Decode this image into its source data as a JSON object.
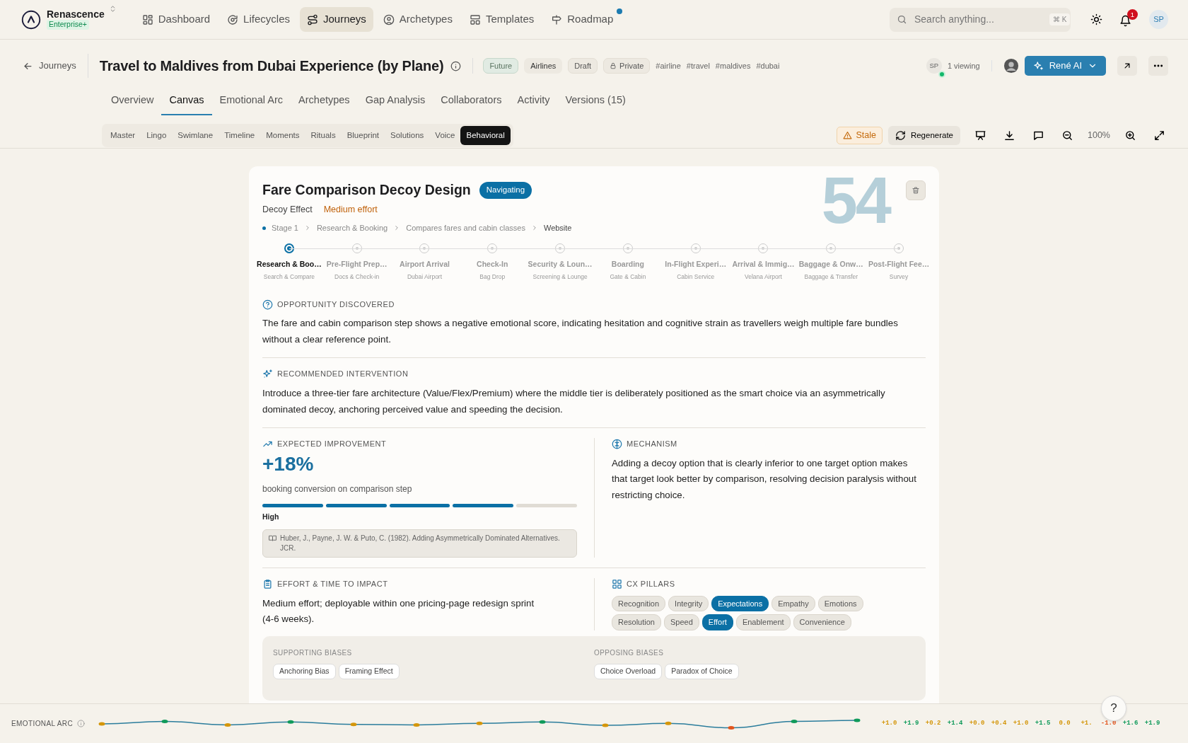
{
  "brand": {
    "name": "Renascence",
    "plan": "Enterprise+"
  },
  "nav": [
    {
      "label": "Dashboard",
      "selected": false,
      "has_update": false
    },
    {
      "label": "Lifecycles",
      "selected": false,
      "has_update": false
    },
    {
      "label": "Journeys",
      "selected": true,
      "has_update": false
    },
    {
      "label": "Archetypes",
      "selected": false,
      "has_update": false
    },
    {
      "label": "Templates",
      "selected": false,
      "has_update": false
    },
    {
      "label": "Roadmap",
      "selected": false,
      "has_update": true
    }
  ],
  "search": {
    "placeholder": "Search anything...",
    "shortcut": "⌘ K"
  },
  "notifications": "1",
  "user_initials": "SP",
  "header": {
    "back": "Journeys",
    "title": "Travel to Maldives from Dubai Experience (by Plane)",
    "tags": [
      {
        "label": "Future",
        "kind": "status"
      },
      {
        "label": "Airlines",
        "kind": "category"
      },
      {
        "label": "Draft",
        "kind": "plain"
      },
      {
        "label": "Private",
        "kind": "lock"
      }
    ],
    "hashtags": [
      "#airline",
      "#travel",
      "#maldives",
      "#dubai"
    ],
    "viewer_initials": "SP",
    "viewing": "1 viewing",
    "ai_button": "René AI"
  },
  "tabs": [
    {
      "label": "Overview",
      "selected": false
    },
    {
      "label": "Canvas",
      "selected": true
    },
    {
      "label": "Emotional Arc",
      "selected": false
    },
    {
      "label": "Archetypes",
      "selected": false
    },
    {
      "label": "Gap Analysis",
      "selected": false
    },
    {
      "label": "Collaborators",
      "selected": false
    },
    {
      "label": "Activity",
      "selected": false
    },
    {
      "label": "Versions (15)",
      "selected": false
    }
  ],
  "views": [
    {
      "label": "Master",
      "selected": false
    },
    {
      "label": "Lingo",
      "selected": false
    },
    {
      "label": "Swimlane",
      "selected": false
    },
    {
      "label": "Timeline",
      "selected": false
    },
    {
      "label": "Moments",
      "selected": false
    },
    {
      "label": "Rituals",
      "selected": false
    },
    {
      "label": "Blueprint",
      "selected": false
    },
    {
      "label": "Solutions",
      "selected": false
    },
    {
      "label": "Voice",
      "selected": false
    },
    {
      "label": "Behavioral",
      "selected": true
    }
  ],
  "toolbar": {
    "stale": "Stale",
    "regenerate": "Regenerate",
    "zoom": "100%"
  },
  "card": {
    "watermark": "54",
    "title": "Fare Comparison Decoy Design",
    "status": "Navigating",
    "bias": "Decoy Effect",
    "effort": "Medium effort",
    "breadcrumb": [
      "Stage 1",
      "Research & Booking",
      "Compares fares and cabin classes",
      "Website"
    ],
    "steps": [
      {
        "title": "Research & Boo…",
        "subtitle": "Search & Compare",
        "selected": true
      },
      {
        "title": "Pre-Flight Prep…",
        "subtitle": "Docs & Check-in",
        "selected": false
      },
      {
        "title": "Airport Arrival",
        "subtitle": "Dubai Airport",
        "selected": false
      },
      {
        "title": "Check-In",
        "subtitle": "Bag Drop",
        "selected": false
      },
      {
        "title": "Security & Loun…",
        "subtitle": "Screening & Lounge",
        "selected": false
      },
      {
        "title": "Boarding",
        "subtitle": "Gate & Cabin",
        "selected": false
      },
      {
        "title": "In-Flight Experi…",
        "subtitle": "Cabin Service",
        "selected": false
      },
      {
        "title": "Arrival & Immig…",
        "subtitle": "Velana Airport",
        "selected": false
      },
      {
        "title": "Baggage & Onw…",
        "subtitle": "Baggage & Transfer",
        "selected": false
      },
      {
        "title": "Post-Flight Fee…",
        "subtitle": "Survey",
        "selected": false
      }
    ],
    "opportunity": {
      "heading": "OPPORTUNITY DISCOVERED",
      "text": "The fare and cabin comparison step shows a negative emotional score, indicating hesitation and cognitive strain as travellers weigh multiple fare bundles without a clear reference point."
    },
    "intervention": {
      "heading": "RECOMMENDED INTERVENTION",
      "text": "Introduce a three-tier fare architecture (Value/Flex/Premium) where the middle tier is deliberately positioned as the smart choice via an asymmetrically dominated decoy, anchoring perceived value and speeding the decision."
    },
    "improvement": {
      "heading": "EXPECTED IMPROVEMENT",
      "value": "+18%",
      "caption": "booking conversion on comparison step",
      "level": 0.8,
      "rating": "High",
      "citation": "Huber, J., Payne, J. W. & Puto, C. (1982). Adding Asymmetrically Dominated Alternatives. JCR."
    },
    "mechanism": {
      "heading": "MECHANISM",
      "text": "Adding a decoy option that is clearly inferior to one target option makes that target look better by comparison, resolving decision paralysis without restricting choice."
    },
    "effort_section": {
      "heading": "EFFORT & TIME TO IMPACT",
      "text": "Medium effort; deployable within one pricing-page redesign sprint (4-6 weeks)."
    },
    "pillars": {
      "heading": "CX PILLARS",
      "items": [
        {
          "label": "Recognition",
          "selected": false
        },
        {
          "label": "Integrity",
          "selected": false
        },
        {
          "label": "Expectations",
          "selected": true
        },
        {
          "label": "Empathy",
          "selected": false
        },
        {
          "label": "Emotions",
          "selected": false
        },
        {
          "label": "Resolution",
          "selected": false
        },
        {
          "label": "Speed",
          "selected": false
        },
        {
          "label": "Effort",
          "selected": true
        },
        {
          "label": "Enablement",
          "selected": false
        },
        {
          "label": "Convenience",
          "selected": false
        }
      ]
    },
    "supporting": {
      "heading": "SUPPORTING BIASES",
      "items": [
        "Anchoring Bias",
        "Framing Effect"
      ]
    },
    "opposing": {
      "heading": "OPPOSING BIASES",
      "items": [
        "Choice Overload",
        "Paradox of Choice"
      ]
    }
  },
  "emotional_arc": {
    "label": "EMOTIONAL ARC",
    "scores": [
      {
        "value": "+1.0",
        "color": "#d4960a"
      },
      {
        "value": "+1.9",
        "color": "#0f9a5a"
      },
      {
        "value": "+0.2",
        "color": "#d4960a"
      },
      {
        "value": "+1.4",
        "color": "#0f9a5a"
      },
      {
        "value": "+0.0",
        "color": "#d4960a"
      },
      {
        "value": "+0.4",
        "color": "#d4960a"
      },
      {
        "value": "+1.0",
        "color": "#d4960a"
      },
      {
        "value": "+1.5",
        "color": "#0f9a5a"
      },
      {
        "value": "0.0",
        "color": "#d4960a"
      },
      {
        "value": "+1.",
        "color": "#d4960a"
      },
      {
        "value": "-1.0",
        "color": "#e2541c"
      },
      {
        "value": "+1.6",
        "color": "#0f9a5a"
      },
      {
        "value": "+1.9",
        "color": "#0f9a5a"
      }
    ]
  },
  "help": "?"
}
